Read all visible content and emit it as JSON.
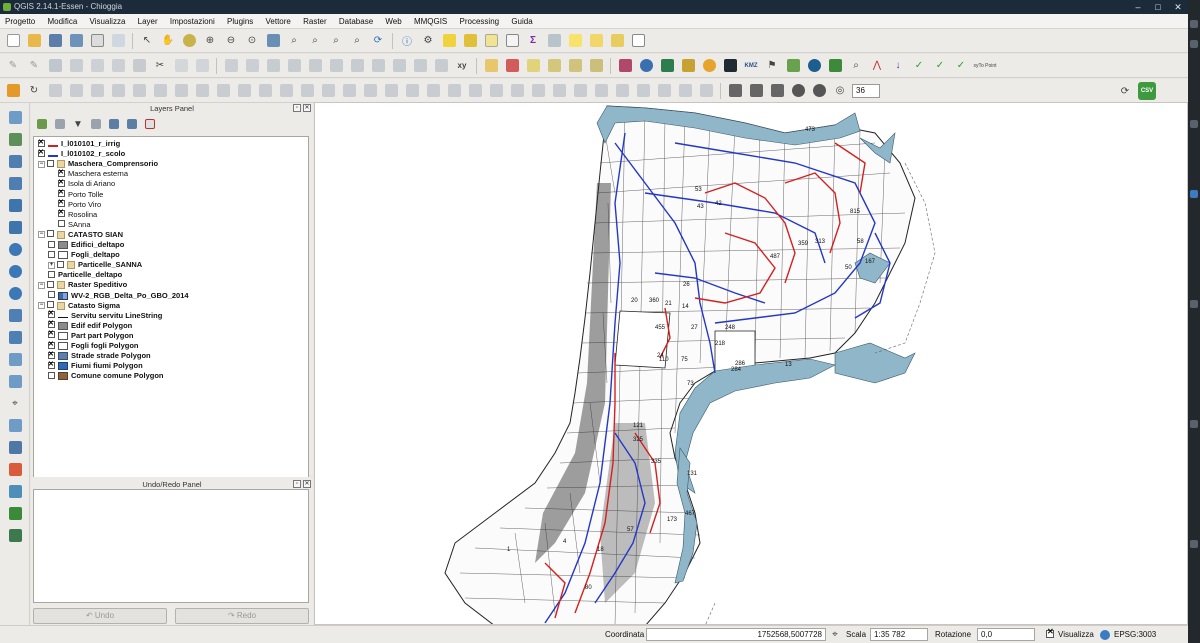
{
  "window": {
    "title": "QGIS 2.14.1-Essen - Chioggia"
  },
  "menu": [
    "Progetto",
    "Modifica",
    "Visualizza",
    "Layer",
    "Impostazioni",
    "Plugins",
    "Vettore",
    "Raster",
    "Database",
    "Web",
    "MMQGIS",
    "Processing",
    "Guida"
  ],
  "toolbar_labels": {
    "xy": "xy",
    "kmz": "KMZ",
    "xytopoint": "xyTo Point",
    "csv": "CSV",
    "spin_value": "36"
  },
  "layers_panel": {
    "title": "Layers Panel"
  },
  "layers": [
    {
      "label": "I_l010101_r_irrig",
      "bold": true,
      "checked": true,
      "indent": 0,
      "symbol": "line-red"
    },
    {
      "label": "I_l010102_r_scolo",
      "bold": true,
      "checked": true,
      "indent": 0,
      "symbol": "line-blue"
    },
    {
      "label": "Maschera_Comprensorio",
      "bold": true,
      "checked": false,
      "indent": 0,
      "symbol": "group",
      "expanded": true
    },
    {
      "label": "Maschera esterna",
      "bold": false,
      "checked": true,
      "indent": 2,
      "symbol": "none"
    },
    {
      "label": "Isola di Ariano",
      "bold": false,
      "checked": true,
      "indent": 2,
      "symbol": "none"
    },
    {
      "label": "Porto Tolle",
      "bold": false,
      "checked": true,
      "indent": 2,
      "symbol": "none"
    },
    {
      "label": "Porto Viro",
      "bold": false,
      "checked": true,
      "indent": 2,
      "symbol": "none"
    },
    {
      "label": "Rosolina",
      "bold": false,
      "checked": true,
      "indent": 2,
      "symbol": "none"
    },
    {
      "label": "SAnna",
      "bold": false,
      "checked": false,
      "indent": 2,
      "symbol": "none"
    },
    {
      "label": "CATASTO SIAN",
      "bold": true,
      "checked": false,
      "indent": 0,
      "symbol": "group",
      "expanded": true
    },
    {
      "label": "Edifici_deltapo",
      "bold": true,
      "checked": false,
      "indent": 1,
      "symbol": "fill-gray"
    },
    {
      "label": "Fogli_deltapo",
      "bold": true,
      "checked": false,
      "indent": 1,
      "symbol": "fill-white"
    },
    {
      "label": "Particelle_SANNA",
      "bold": true,
      "checked": false,
      "indent": 1,
      "symbol": "group",
      "expanded": false
    },
    {
      "label": "Particelle_deltapo",
      "bold": true,
      "checked": false,
      "indent": 1,
      "symbol": "none"
    },
    {
      "label": "Raster Speditivo",
      "bold": true,
      "checked": false,
      "indent": 0,
      "symbol": "group",
      "expanded": true
    },
    {
      "label": "WV-2_RGB_Delta_Po_GBO_2014",
      "bold": true,
      "checked": false,
      "indent": 1,
      "symbol": "raster"
    },
    {
      "label": "Catasto Sigma",
      "bold": true,
      "checked": false,
      "indent": 0,
      "symbol": "group",
      "expanded": true
    },
    {
      "label": "Servitu servitu LineString",
      "bold": true,
      "checked": true,
      "indent": 1,
      "symbol": "line-black"
    },
    {
      "label": "Edif edif Polygon",
      "bold": true,
      "checked": true,
      "indent": 1,
      "symbol": "fill-gray"
    },
    {
      "label": "Part part Polygon",
      "bold": true,
      "checked": true,
      "indent": 1,
      "symbol": "fill-white"
    },
    {
      "label": "Fogli fogli Polygon",
      "bold": true,
      "checked": true,
      "indent": 1,
      "symbol": "fill-white"
    },
    {
      "label": "Strade strade Polygon",
      "bold": true,
      "checked": true,
      "indent": 1,
      "symbol": "fill-blue-gray"
    },
    {
      "label": "Fiumi fiumi Polygon",
      "bold": true,
      "checked": true,
      "indent": 1,
      "symbol": "fill-blue"
    },
    {
      "label": "Comune comune Polygon",
      "bold": true,
      "checked": false,
      "indent": 1,
      "symbol": "fill-brown"
    }
  ],
  "undo_panel": {
    "title": "Undo/Redo Panel",
    "undo": "Undo",
    "redo": "Redo"
  },
  "map": {
    "parcel_labels": [
      "473",
      "42",
      "53",
      "43",
      "815",
      "313",
      "359",
      "58",
      "167",
      "487",
      "50",
      "20",
      "360",
      "21",
      "26",
      "14",
      "455",
      "27",
      "248",
      "218",
      "286",
      "24",
      "110",
      "75",
      "284",
      "73",
      "13",
      "131",
      "335",
      "325",
      "121",
      "467",
      "173",
      "57",
      "18",
      "80",
      "1",
      "4"
    ],
    "colors": {
      "water": "#8fb6c9",
      "irrig": "#d42020",
      "scolo": "#2337c8"
    }
  },
  "status": {
    "coord_label": "Coordinata",
    "coord_value": "1752568,5007728",
    "scale_label": "Scala",
    "scale_value": "1:35 782",
    "rotation_label": "Rotazione",
    "rotation_value": "0,0",
    "render_label": "Visualizza",
    "crs": "EPSG:3003"
  }
}
